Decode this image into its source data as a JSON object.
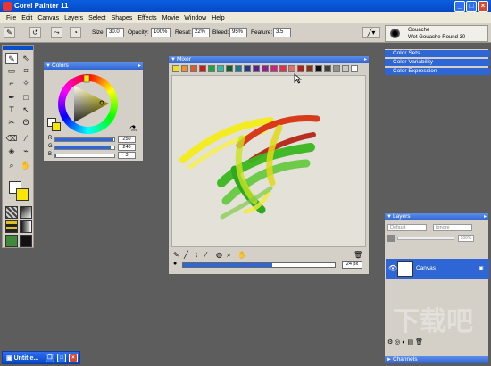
{
  "app": {
    "title": "Corel Painter 11"
  },
  "menu": [
    "File",
    "Edit",
    "Canvas",
    "Layers",
    "Select",
    "Shapes",
    "Effects",
    "Movie",
    "Window",
    "Help"
  ],
  "propbar": {
    "size_label": "Size:",
    "size_value": "30.0",
    "opacity_label": "Opacity:",
    "opacity_value": "100%",
    "resat_label": "Resat:",
    "resat_value": "22%",
    "bleed_label": "Bleed:",
    "bleed_value": "95%",
    "feature_label": "Feature:",
    "feature_value": "3.5",
    "brush_category": "Gouache",
    "brush_variant": "Wet Gouache Round 30"
  },
  "colors_panel": {
    "title": "Colors",
    "sliders": [
      {
        "label": "R",
        "value": "250",
        "fraction": 0.98
      },
      {
        "label": "G",
        "value": "240",
        "fraction": 0.94
      },
      {
        "label": "B",
        "value": "3",
        "fraction": 0.01
      }
    ],
    "main_color": "#fae603",
    "additional_color": "#ffffff"
  },
  "mixer_panel": {
    "title": "Mixer",
    "swatch_colors": [
      "#f0e020",
      "#f09030",
      "#e05a28",
      "#d01818",
      "#18a840",
      "#28c0a0",
      "#106030",
      "#187890",
      "#203890",
      "#582090",
      "#902090",
      "#d02080",
      "#e03050",
      "#e07070",
      "#b02020",
      "#883010",
      "#101010",
      "#404040",
      "#909090",
      "#c8c8c8",
      "#ffffff"
    ],
    "zoom_value": "24 px"
  },
  "right_panels": {
    "items": [
      "Color Sets",
      "Color Variability",
      "Color Expression"
    ]
  },
  "layers_panel": {
    "title": "Layers",
    "composite_method": "Default",
    "composite_depth": "Ignore",
    "opacity_value": "100%",
    "canvas_layer": "Canvas"
  },
  "channels_panel": {
    "title": "Channels"
  },
  "document": {
    "title": "Untitle..."
  },
  "watermark": "下载吧"
}
